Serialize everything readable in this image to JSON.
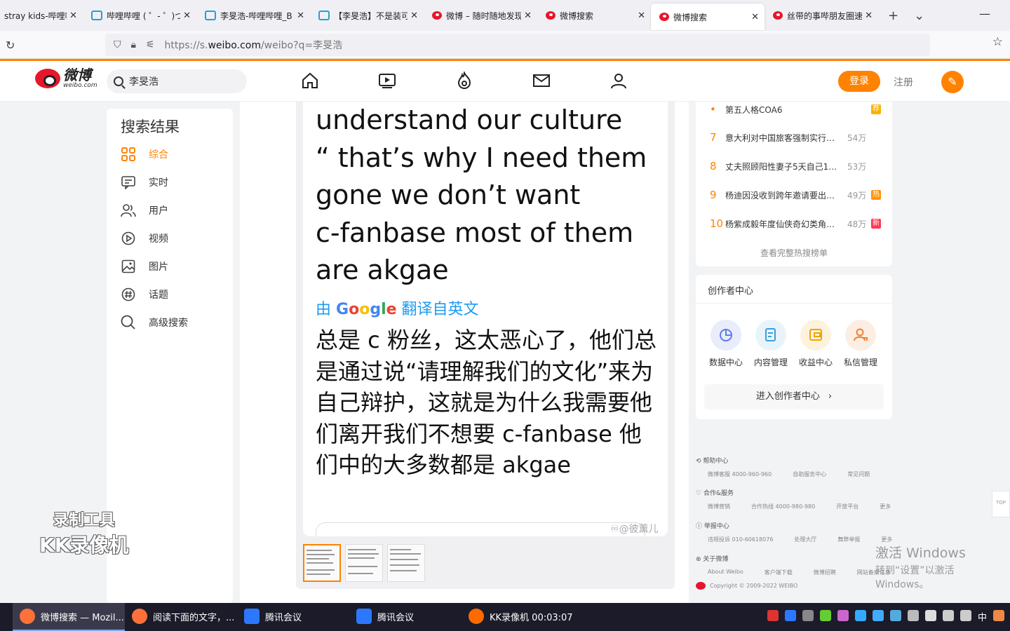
{
  "browser": {
    "tabs": [
      {
        "label": "stray kids-哔哩哔哩",
        "icon": "bilibili-icon"
      },
      {
        "label": "哔哩哔哩 ( ゜- ゜)つロ",
        "icon": "bilibili-icon"
      },
      {
        "label": "李旻浩-哔哩哔哩_B",
        "icon": "bilibili-icon"
      },
      {
        "label": "【李旻浩】不是装可",
        "icon": "bilibili-icon"
      },
      {
        "label": "微博 – 随时随地发现",
        "icon": "weibo-icon"
      },
      {
        "label": "微博搜索",
        "icon": "weibo-icon"
      },
      {
        "label": "微博搜索",
        "icon": "weibo-icon",
        "active": true
      },
      {
        "label": "丝带的事哔朋友圈速",
        "icon": "weibo-icon"
      }
    ],
    "url_prefix": "https://s.",
    "url_domain": "weibo.com",
    "url_rest": "/weibo?q=李旻浩"
  },
  "header": {
    "logo_cn": "微博",
    "logo_en": "weibo.com",
    "search_value": "李旻浩",
    "login_label": "登录",
    "register_label": "注册"
  },
  "sidebar": {
    "title": "搜索结果",
    "items": [
      {
        "label": "综合",
        "icon": "grid-icon",
        "active": true
      },
      {
        "label": "实时",
        "icon": "message-icon"
      },
      {
        "label": "用户",
        "icon": "users-icon"
      },
      {
        "label": "视频",
        "icon": "play-icon"
      },
      {
        "label": "图片",
        "icon": "image-icon"
      },
      {
        "label": "话题",
        "icon": "hashtag-icon"
      },
      {
        "label": "高级搜索",
        "icon": "search-icon"
      }
    ]
  },
  "post": {
    "english_text": "understand our culture\n“ that’s why I need them\ngone we don’t want\nc-fanbase most of them\nare akgae",
    "translated_by_prefix": "由",
    "translated_by_suffix": "翻译自英文",
    "google_label": "Google",
    "chinese_text": "总是 c 粉丝，这太恶心了，他们总是通过说“请理解我们的文化”来为自己辩护，这就是为什么我需要他们离开我们不想要 c-fanbase 他们中的大多数都是 akgae",
    "watermark": "@彼薰儿"
  },
  "hot_list": {
    "items": [
      {
        "rank": "•",
        "title": "第五人格COA6",
        "heat": "",
        "badge": "荐",
        "badge_color": "#ffb000"
      },
      {
        "rank": "7",
        "title": "意大利对中国旅客强制实行…",
        "heat": "54万",
        "badge": "",
        "badge_color": ""
      },
      {
        "rank": "8",
        "title": "丈夫照顾阳性妻子5天自己1…",
        "heat": "53万",
        "badge": "",
        "badge_color": ""
      },
      {
        "rank": "9",
        "title": "杨迪因没收到跨年邀请要出…",
        "heat": "49万",
        "badge": "热",
        "badge_color": "#ff9406"
      },
      {
        "rank": "10",
        "title": "杨紫成毅年度仙侠奇幻类角…",
        "heat": "48万",
        "badge": "新",
        "badge_color": "#ff3852"
      }
    ],
    "view_all": "查看完整热搜榜单"
  },
  "creator": {
    "title": "创作者中心",
    "items": [
      {
        "label": "数据中心",
        "color": "#e9ecfb"
      },
      {
        "label": "内容管理",
        "color": "#e8f4fb"
      },
      {
        "label": "收益中心",
        "color": "#fdf3dd"
      },
      {
        "label": "私信管理",
        "color": "#fdeee4"
      }
    ],
    "enter_label": "进入创作者中心"
  },
  "footer": {
    "sections": [
      {
        "title": "帮助中心",
        "links": [
          "微博客服 4000-960-960",
          "自助服务中心",
          "常见问题"
        ]
      },
      {
        "title": "合作&服务",
        "links": [
          "微博营销",
          "合作热线 4000-980-980",
          "开放平台",
          "更多"
        ]
      },
      {
        "title": "举报中心",
        "links": [
          "违规投诉 010-60618076",
          "处理大厅",
          "舞弊举报",
          "更多"
        ]
      },
      {
        "title": "关于微博",
        "links": [
          "About Weibo",
          "客户端下载",
          "微博招聘",
          "网站备案信息"
        ]
      }
    ],
    "copyright": "Copyright © 2009-2022 WEIBO"
  },
  "overlay": {
    "recorder_line1": "录制工具",
    "recorder_line2": "KK录像机",
    "activate_line1": "激活 Windows",
    "activate_line2": "转到“设置”以激活 Windows。",
    "to_top": "TOP"
  },
  "taskbar": {
    "items": [
      {
        "label": "微博搜索 — Mozil...",
        "color": "#ff7139",
        "active": true
      },
      {
        "label": "阅读下面的文字，...",
        "color": "#ff7139"
      },
      {
        "label": "腾讯会议",
        "color": "#2b78ff"
      },
      {
        "label": "腾讯会议",
        "color": "#2b78ff"
      },
      {
        "label": "KK录像机 00:03:07",
        "color": "#ff6a00"
      }
    ],
    "ime": "中"
  }
}
